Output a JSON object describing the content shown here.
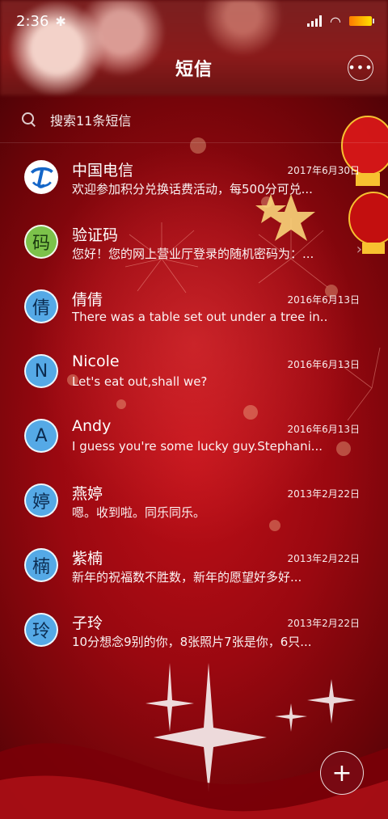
{
  "status_bar": {
    "time": "2:36"
  },
  "header": {
    "title": "短信",
    "more_label": "•••"
  },
  "search": {
    "placeholder": "搜索11条短信"
  },
  "messages": [
    {
      "name": "中国电信",
      "date": "2017年6月30日",
      "preview": "欢迎参加积分兑换话费活动，每500分可兑...",
      "avatar": "telecom-logo",
      "avatar_text": "e"
    },
    {
      "name": "验证码",
      "date": "",
      "preview": "您好！您的网上营业厅登录的随机密码为：...",
      "avatar": "letter",
      "avatar_text": "码"
    },
    {
      "name": "倩倩",
      "date": "2016年6月13日",
      "preview": "There was a table set out under a tree in...",
      "avatar": "letter",
      "avatar_text": "倩"
    },
    {
      "name": "Nicole",
      "date": "2016年6月13日",
      "preview": "Let's eat out,shall we?",
      "avatar": "letter",
      "avatar_text": "N"
    },
    {
      "name": "Andy",
      "date": "2016年6月13日",
      "preview": "I guess you're some lucky guy.Stephani...",
      "avatar": "letter",
      "avatar_text": "A"
    },
    {
      "name": "燕婷",
      "date": "2013年2月22日",
      "preview": "嗯。收到啦。同乐同乐。",
      "avatar": "letter",
      "avatar_text": "婷"
    },
    {
      "name": "紫楠",
      "date": "2013年2月22日",
      "preview": "新年的祝福数不胜数，新年的愿望好多好...",
      "avatar": "letter",
      "avatar_text": "楠"
    },
    {
      "name": "子玲",
      "date": "2013年2月22日",
      "preview": "10分想念9别的你，8张照片7张是你，6只...",
      "avatar": "letter",
      "avatar_text": "玲"
    }
  ],
  "fab": {
    "label": "+"
  },
  "colors": {
    "background": "#9a0810",
    "avatar_blue": "#55a9e6",
    "avatar_green": "#7cc24a",
    "telecom_blue": "#1466c8"
  }
}
